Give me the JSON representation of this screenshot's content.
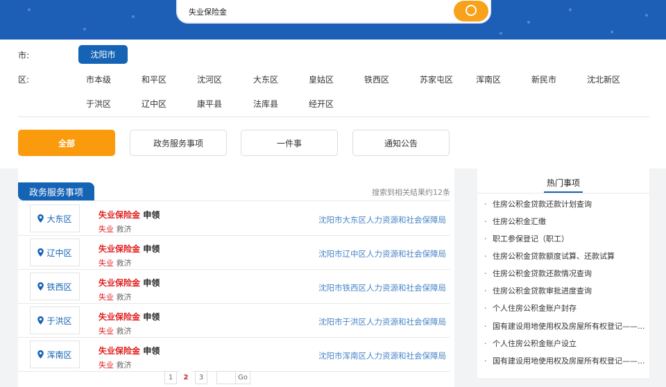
{
  "search": {
    "value": "失业保险金"
  },
  "filters": {
    "city_label": "市:",
    "district_label": "区:",
    "selected_city": "沈阳市",
    "districts_row1": [
      "市本级",
      "和平区",
      "沈河区",
      "大东区",
      "皇姑区",
      "铁西区",
      "苏家屯区",
      "浑南区",
      "新民市",
      "沈北新区"
    ],
    "districts_row2": [
      "于洪区",
      "辽中区",
      "康平县",
      "法库县",
      "经开区"
    ]
  },
  "tabs": [
    "全部",
    "政务服务事项",
    "一件事",
    "通知公告"
  ],
  "results": {
    "header": "政务服务事项",
    "count_text": "搜索到相关结果约12条",
    "items": [
      {
        "location": "大东区",
        "title_hl": "失业保险金",
        "title_rest": "申领",
        "sub_hl": "失业",
        "sub_rest": "救济",
        "dept": "沈阳市大东区人力资源和社会保障局"
      },
      {
        "location": "辽中区",
        "title_hl": "失业保险金",
        "title_rest": "申领",
        "sub_hl": "失业",
        "sub_rest": "救济",
        "dept": "沈阳市辽中区人力资源和社会保障局"
      },
      {
        "location": "铁西区",
        "title_hl": "失业保险金",
        "title_rest": "申领",
        "sub_hl": "失业",
        "sub_rest": "救济",
        "dept": "沈阳市铁西区人力资源和社会保障局"
      },
      {
        "location": "于洪区",
        "title_hl": "失业保险金",
        "title_rest": "申领",
        "sub_hl": "失业",
        "sub_rest": "救济",
        "dept": "沈阳市于洪区人力资源和社会保障局"
      },
      {
        "location": "浑南区",
        "title_hl": "失业保险金",
        "title_rest": "申领",
        "sub_hl": "失业",
        "sub_rest": "救济",
        "dept": "沈阳市浑南区人力资源和社会保障局"
      }
    ]
  },
  "pagination": {
    "pages": [
      "1",
      "2",
      "3"
    ],
    "current": "2",
    "go_label": "Go"
  },
  "hot": {
    "title": "热门事项",
    "items": [
      "住房公积金贷款还款计划查询",
      "住房公积金汇缴",
      "职工参保登记（职工）",
      "住房公积金贷款额度试算、还款试算",
      "住房公积金贷款还款情况查询",
      "住房公积金贷款审批进度查询",
      "个人住房公积金账户封存",
      "国有建设用地使用权及房屋所有权登记——...",
      "个人住房公积金账户设立",
      "国有建设用地使用权及房屋所有权登记——..."
    ]
  },
  "colors": {
    "brand_blue": "#1563b5",
    "accent_orange": "#f99b0c",
    "highlight_red": "#e02020"
  }
}
